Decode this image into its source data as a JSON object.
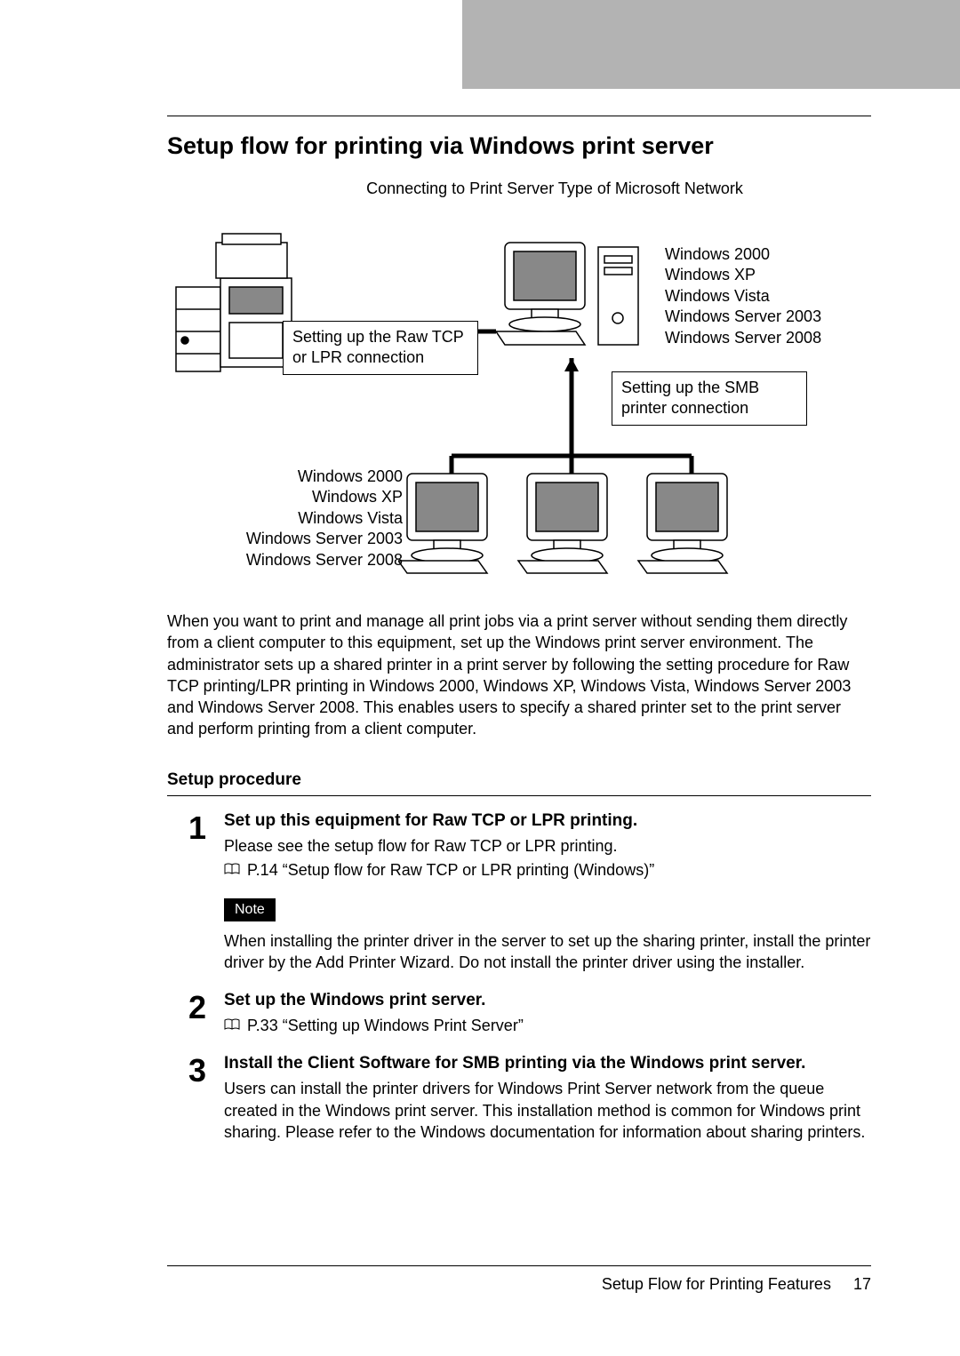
{
  "heading": "Setup flow for printing via Windows print server",
  "diagram": {
    "caption": "Connecting to Print Server Type of Microsoft Network",
    "label_rawtcp": "Setting up the Raw TCP or LPR connection",
    "label_smb": "Setting up the SMB printer connection",
    "os_list": {
      "l0": "Windows 2000",
      "l1": "Windows XP",
      "l2": "Windows Vista",
      "l3": "Windows Server 2003",
      "l4": "Windows Server 2008"
    }
  },
  "body_para": "When you want to print and manage all print jobs via a print server without sending them directly from a client computer to this equipment, set up the Windows print server environment. The administrator sets up a shared printer in a print server by following the setting procedure for Raw TCP printing/LPR printing in Windows 2000, Windows XP, Windows Vista, Windows Server 2003 and Windows Server 2008. This enables users to specify a shared printer set to the print server and perform printing from a client computer.",
  "subheading": "Setup procedure",
  "steps": {
    "s1": {
      "num": "1",
      "title": "Set up this equipment for Raw TCP or LPR printing.",
      "text": "Please see the setup flow for Raw TCP or LPR printing.",
      "ref": "P.14 “Setup flow for Raw TCP or LPR printing (Windows)”",
      "note_label": "Note",
      "note_text": "When installing the printer driver in the server to set up the sharing printer, install the printer driver by the Add Printer Wizard. Do not install the printer driver using the installer."
    },
    "s2": {
      "num": "2",
      "title": "Set up the Windows print server.",
      "ref": "P.33 “Setting up Windows Print Server”"
    },
    "s3": {
      "num": "3",
      "title": "Install the Client Software for SMB printing via the Windows print server.",
      "text": "Users can install the printer drivers for Windows Print Server network from the queue created in the Windows print server. This installation method is common for Windows print sharing. Please refer to the Windows documentation for information about sharing printers."
    }
  },
  "footer": {
    "section": "Setup Flow for Printing Features",
    "page": "17"
  }
}
